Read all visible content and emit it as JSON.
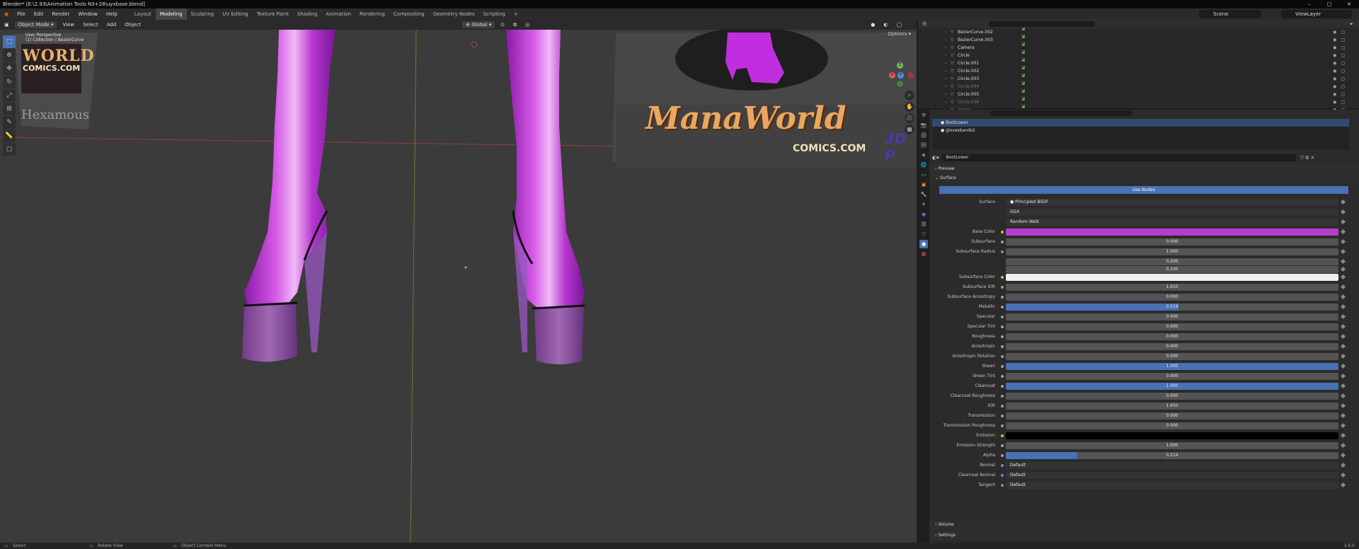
{
  "window": {
    "title": "Blender* [E:\\2.93\\Animation Tools N3+28\\uyxbase.blend]",
    "controls": [
      "–",
      "□",
      "✕"
    ]
  },
  "menu": [
    "File",
    "Edit",
    "Render",
    "Window",
    "Help"
  ],
  "workspaces": [
    {
      "label": "Layout",
      "active": false
    },
    {
      "label": "Modeling",
      "active": true
    },
    {
      "label": "Sculpting",
      "active": false
    },
    {
      "label": "UV Editing",
      "active": false
    },
    {
      "label": "Texture Paint",
      "active": false
    },
    {
      "label": "Shading",
      "active": false
    },
    {
      "label": "Animation",
      "active": false
    },
    {
      "label": "Rendering",
      "active": false
    },
    {
      "label": "Compositing",
      "active": false
    },
    {
      "label": "Geometry Nodes",
      "active": false
    },
    {
      "label": "Scripting",
      "active": false
    },
    {
      "label": "+",
      "active": false
    }
  ],
  "scene": "Scene",
  "view_layer": "ViewLayer",
  "viewport": {
    "mode": "Object Mode",
    "menus": [
      "View",
      "Select",
      "Add",
      "Object"
    ],
    "transform": "Global",
    "options": "Options",
    "overlay_line1": "User Perspective",
    "overlay_line2": "(1) Collection | BezierCurve",
    "watermark": "Hexamous",
    "logo_left_main": "WORLD",
    "logo_left_sub": "COMICS.COM",
    "logo_right_main": "ManaWorld",
    "logo_right_sub": "COMICS.COM",
    "logo_right_extra": "3D P",
    "gizmo": {
      "x": "X",
      "y": "Y",
      "z": "Z"
    }
  },
  "outliner": {
    "items": [
      {
        "label": "BezierCurve.002",
        "dim": false
      },
      {
        "label": "BezierCurve.003",
        "dim": false
      },
      {
        "label": "Camera",
        "dim": false
      },
      {
        "label": "Circle",
        "dim": false
      },
      {
        "label": "Circle.001",
        "dim": false
      },
      {
        "label": "Circle.002",
        "dim": false
      },
      {
        "label": "Circle.003",
        "dim": false
      },
      {
        "label": "Circle.004",
        "dim": true
      },
      {
        "label": "Circle.005",
        "dim": false
      },
      {
        "label": "Circle.006",
        "dim": true
      },
      {
        "label": "Empty",
        "dim": true
      }
    ]
  },
  "material": {
    "slots": [
      "BootLower",
      "glovesbands2"
    ],
    "name": "BootLower",
    "preview": "Preview",
    "surface_section": "Surface",
    "use_nodes": "Use Nodes",
    "surface_label": "Surface",
    "surface_shader": "Principled BSDF",
    "distribution": "GGX",
    "subsurface_method": "Random Walk",
    "volume": "Volume",
    "settings": "Settings",
    "properties": [
      {
        "label": "Base Color",
        "type": "color",
        "color": "#b83bd0",
        "dot": "yellow"
      },
      {
        "label": "Subsurface",
        "type": "num",
        "value": "0.000",
        "fill": 0,
        "dot": "gray"
      },
      {
        "label": "Subsurface Radius",
        "type": "num",
        "value": "1.000",
        "fill": 0,
        "dot": "blue"
      },
      {
        "label": "",
        "type": "num",
        "value": "0.200",
        "fill": 0,
        "dot": "none"
      },
      {
        "label": "",
        "type": "num",
        "value": "0.100",
        "fill": 0,
        "dot": "none"
      },
      {
        "label": "Subsurface Color",
        "type": "color",
        "color": "#efefef",
        "dot": "yellow"
      },
      {
        "label": "Subsurface IOR",
        "type": "num",
        "value": "1.010",
        "fill": 0,
        "dot": "gray"
      },
      {
        "label": "Subsurface Anisotropy",
        "type": "num",
        "value": "0.000",
        "fill": 0,
        "dot": "gray"
      },
      {
        "label": "Metallic",
        "type": "num",
        "value": "0.519",
        "fill": 0.519,
        "dot": "gray"
      },
      {
        "label": "Specular",
        "type": "num",
        "value": "0.000",
        "fill": 0,
        "dot": "gray"
      },
      {
        "label": "Specular Tint",
        "type": "num",
        "value": "0.000",
        "fill": 0,
        "dot": "gray"
      },
      {
        "label": "Roughness",
        "type": "num",
        "value": "0.000",
        "fill": 0,
        "dot": "gray"
      },
      {
        "label": "Anisotropic",
        "type": "num",
        "value": "0.000",
        "fill": 0,
        "dot": "gray"
      },
      {
        "label": "Anisotropic Rotation",
        "type": "num",
        "value": "0.000",
        "fill": 0,
        "dot": "gray"
      },
      {
        "label": "Sheen",
        "type": "num",
        "value": "1.000",
        "fill": 1,
        "dot": "gray"
      },
      {
        "label": "Sheen Tint",
        "type": "num",
        "value": "0.000",
        "fill": 0,
        "dot": "gray"
      },
      {
        "label": "Clearcoat",
        "type": "num",
        "value": "1.000",
        "fill": 1,
        "dot": "gray"
      },
      {
        "label": "Clearcoat Roughness",
        "type": "num",
        "value": "0.000",
        "fill": 0,
        "dot": "gray"
      },
      {
        "label": "IOR",
        "type": "num",
        "value": "1.450",
        "fill": 0,
        "dot": "gray"
      },
      {
        "label": "Transmission",
        "type": "num",
        "value": "0.000",
        "fill": 0,
        "dot": "gray"
      },
      {
        "label": "Transmission Roughness",
        "type": "num",
        "value": "0.000",
        "fill": 0,
        "dot": "gray"
      },
      {
        "label": "Emission",
        "type": "color",
        "color": "#000000",
        "dot": "yellow"
      },
      {
        "label": "Emission Strength",
        "type": "num",
        "value": "1.000",
        "fill": 0,
        "dot": "gray"
      },
      {
        "label": "Alpha",
        "type": "num",
        "value": "0.214",
        "fill": 0.214,
        "dot": "gray"
      },
      {
        "label": "Normal",
        "type": "text",
        "value": "Default",
        "dot": "blue"
      },
      {
        "label": "Clearcoat Normal",
        "type": "text",
        "value": "Default",
        "dot": "blue"
      },
      {
        "label": "Tangent",
        "type": "text",
        "value": "Default",
        "dot": "blue"
      }
    ]
  },
  "status": {
    "select": "Select",
    "rotate": "Rotate View",
    "context": "Object Context Menu",
    "version": "3.6.0"
  }
}
